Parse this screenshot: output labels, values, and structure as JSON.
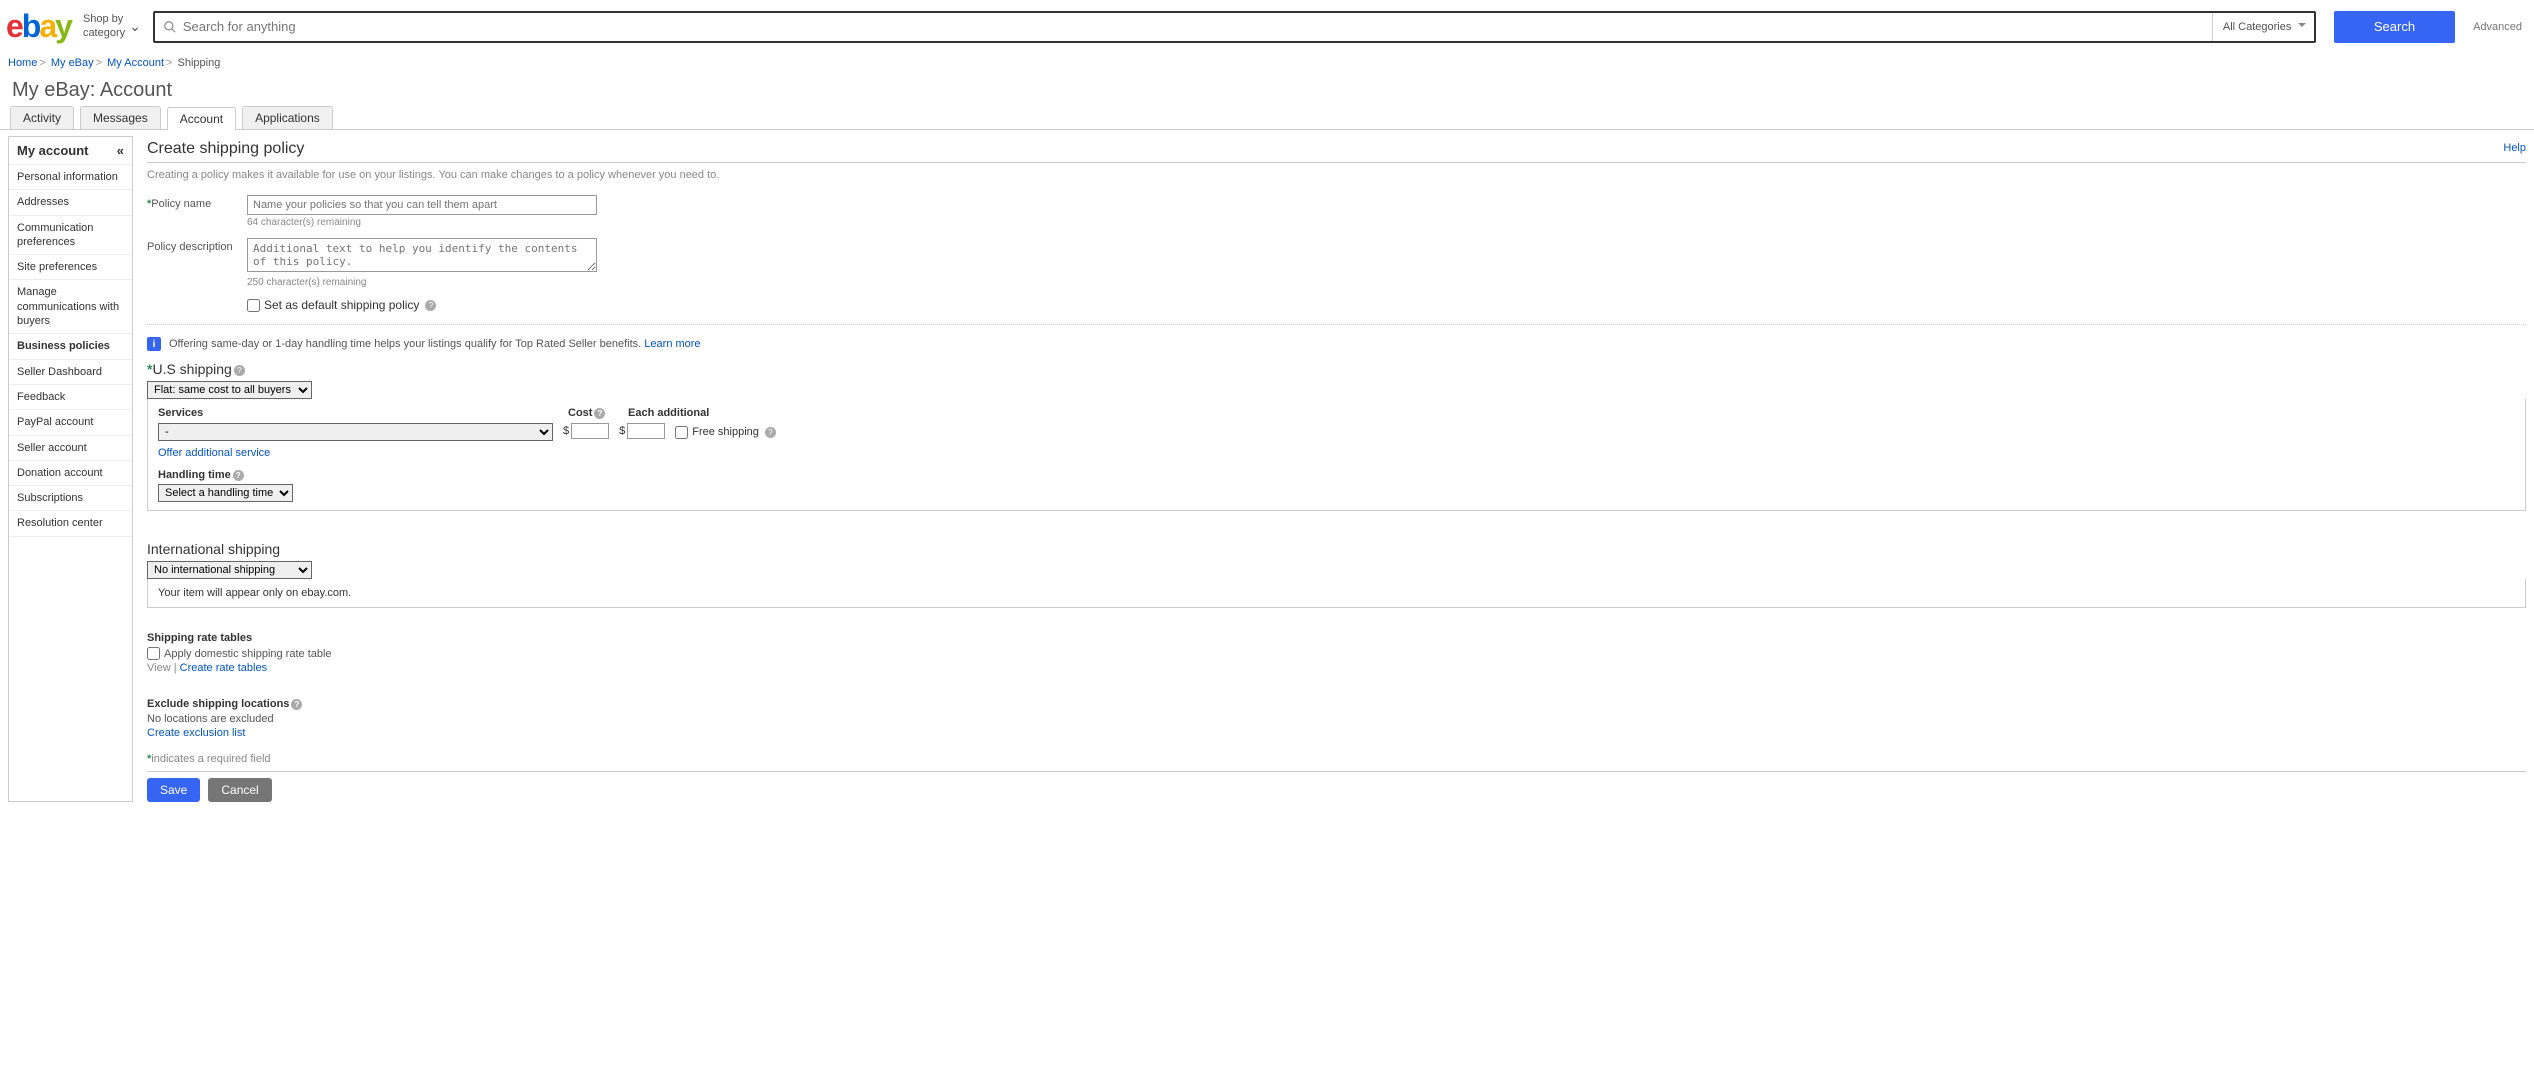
{
  "header": {
    "shop_by_line1": "Shop by",
    "shop_by_line2": "category",
    "search_placeholder": "Search for anything",
    "category_selected": "All Categories",
    "search_button": "Search",
    "advanced": "Advanced"
  },
  "breadcrumb": {
    "items": [
      "Home",
      "My eBay",
      "My Account"
    ],
    "current": "Shipping"
  },
  "page_title": "My eBay: Account",
  "tabs": [
    "Activity",
    "Messages",
    "Account",
    "Applications"
  ],
  "active_tab": "Account",
  "sidebar": {
    "heading": "My account",
    "items": [
      "Personal information",
      "Addresses",
      "Communication preferences",
      "Site preferences",
      "Manage communications with buyers",
      "Business policies",
      "Seller Dashboard",
      "Feedback",
      "PayPal account",
      "Seller account",
      "Donation account",
      "Subscriptions",
      "Resolution center"
    ],
    "active_item": "Business policies"
  },
  "main": {
    "help": "Help",
    "title": "Create shipping policy",
    "intro": "Creating a policy makes it available for use on your listings. You can make changes to a policy whenever you need to.",
    "policy_name_label": "Policy name",
    "policy_name_placeholder": "Name your policies so that you can tell them apart",
    "policy_name_counter": "64 character(s) remaining",
    "policy_desc_label": "Policy description",
    "policy_desc_placeholder": "Additional text to help you identify the contents of this policy.",
    "policy_desc_counter": "250 character(s) remaining",
    "default_checkbox": "Set as default shipping policy",
    "info_banner": "Offering same-day or 1-day handling time helps your listings qualify for Top Rated Seller benefits.",
    "learn_more": "Learn more",
    "us_shipping": {
      "title": "U.S shipping",
      "type_selected": "Flat: same cost to all buyers",
      "services_label": "Services",
      "cost_label": "Cost",
      "each_additional_label": "Each additional",
      "service_selected": "-",
      "free_shipping": "Free shipping",
      "offer_additional": "Offer additional service",
      "handling_time_label": "Handling time",
      "handling_time_selected": "Select a handling time"
    },
    "intl_shipping": {
      "title": "International shipping",
      "selected": "No international shipping",
      "note": "Your item will appear only on ebay.com."
    },
    "rate_tables": {
      "title": "Shipping rate tables",
      "apply_domestic": "Apply domestic shipping rate table",
      "view": "View",
      "create": "Create rate tables"
    },
    "exclude": {
      "title": "Exclude shipping locations",
      "none": "No locations are excluded",
      "create": "Create exclusion list"
    },
    "required_note": "indicates a required field",
    "save": "Save",
    "cancel": "Cancel"
  }
}
